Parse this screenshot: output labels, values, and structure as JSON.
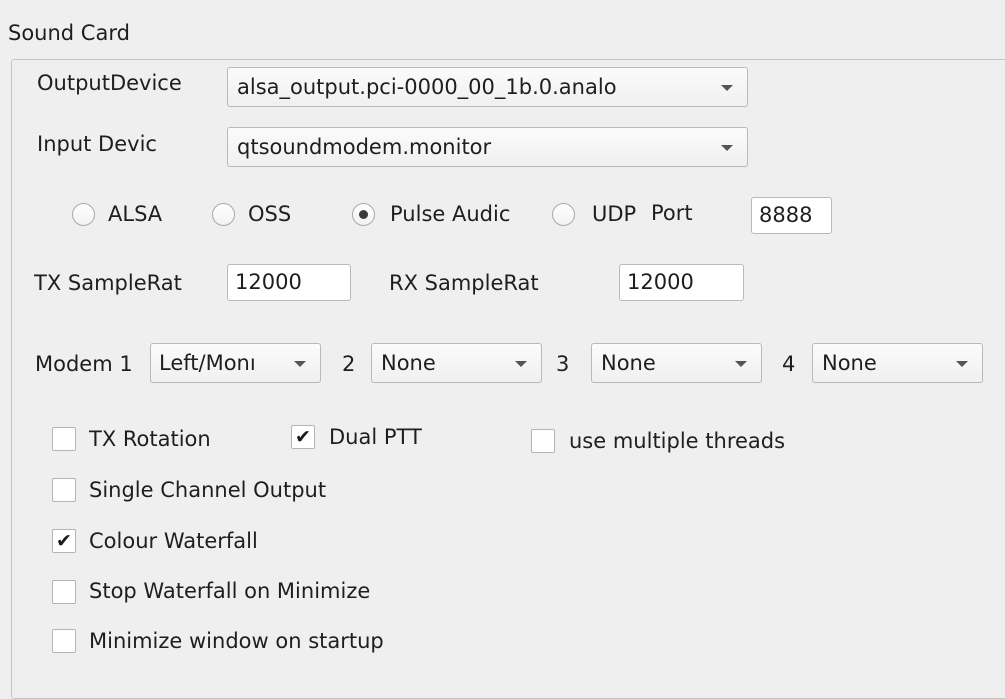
{
  "group": {
    "title": "Sound Card"
  },
  "output_device": {
    "label": "OutputDevice",
    "value": "alsa_output.pci-0000_00_1b.0.analo"
  },
  "input_device": {
    "label": "Input Devic",
    "value": "qtsoundmodem.monitor"
  },
  "audio_system": {
    "options": [
      {
        "label": "ALSA",
        "selected": false
      },
      {
        "label": "OSS",
        "selected": false
      },
      {
        "label": "Pulse Audic",
        "selected": true
      },
      {
        "label": "UDP",
        "selected": false
      }
    ],
    "port_label": "Port",
    "port_value": "8888"
  },
  "sample_rates": {
    "tx_label": "TX SampleRat",
    "tx_value": "12000",
    "rx_label": "RX SampleRat",
    "rx_value": "12000"
  },
  "modems": {
    "label_1": "Modem 1",
    "value_1": "Left/Monı",
    "label_2": "2",
    "value_2": "None",
    "label_3": "3",
    "value_3": "None",
    "label_4": "4",
    "value_4": "None"
  },
  "options": {
    "tx_rotation": {
      "label": "TX Rotation",
      "checked": false
    },
    "dual_ptt": {
      "label": "Dual PTT",
      "checked": true
    },
    "multi_threads": {
      "label": "use multiple threads",
      "checked": false
    },
    "single_channel": {
      "label": "Single Channel Output",
      "checked": false
    },
    "colour_waterfall": {
      "label": "Colour Waterfall",
      "checked": true
    },
    "stop_waterfall": {
      "label": "Stop Waterfall on Minimize",
      "checked": false
    },
    "minimize_startup": {
      "label": "Minimize window on startup",
      "checked": false
    }
  },
  "icons": {
    "check": "✔",
    "dropdown": "chevron-down-icon"
  }
}
